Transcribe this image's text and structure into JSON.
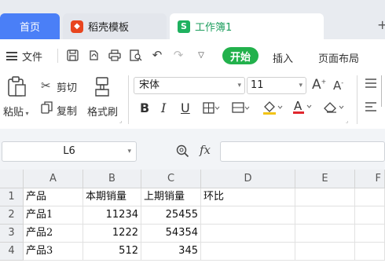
{
  "tabs": {
    "home": "首页",
    "docer": "稻壳模板",
    "workbook": "工作簿1"
  },
  "menu": {
    "file": "文件",
    "start": "开始",
    "insert": "插入",
    "page_layout": "页面布局"
  },
  "ribbon": {
    "paste": "粘贴",
    "cut": "剪切",
    "copy": "复制",
    "format_painter": "格式刷",
    "font_name": "宋体",
    "font_size": "11"
  },
  "formula_bar": {
    "name_box": "L6",
    "fx": "fx",
    "formula": ""
  },
  "sheet": {
    "columns": [
      "A",
      "B",
      "C",
      "D",
      "E",
      "F"
    ],
    "rows": [
      {
        "num": "1",
        "cells": [
          "产品",
          "本期销量",
          "上期销量",
          "环比",
          "",
          ""
        ]
      },
      {
        "num": "2",
        "cells": [
          "产品1",
          "11234",
          "25455",
          "",
          "",
          ""
        ]
      },
      {
        "num": "3",
        "cells": [
          "产品2",
          "1222",
          "54354",
          "",
          "",
          ""
        ]
      },
      {
        "num": "4",
        "cells": [
          "产品3",
          "512",
          "345",
          "",
          "",
          ""
        ]
      }
    ]
  },
  "colors": {
    "accent_green": "#22b14c",
    "home_tab_blue": "#4a7ff7",
    "workbook_green": "#1e9e5e"
  }
}
